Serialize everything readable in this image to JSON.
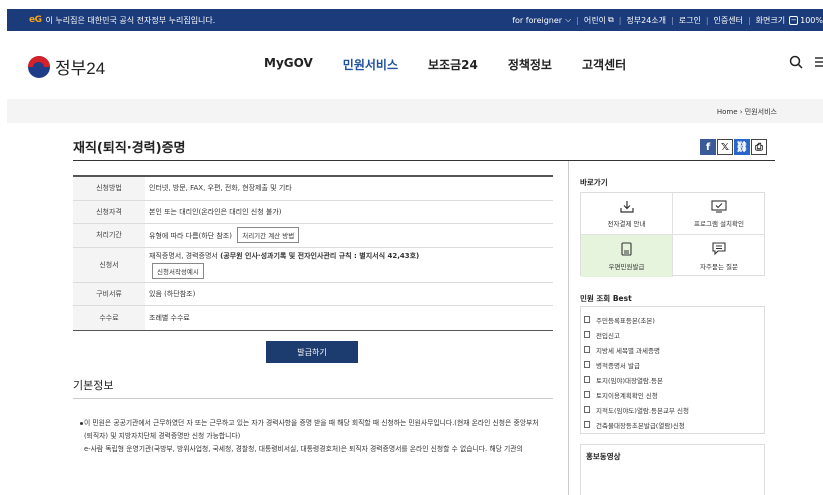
{
  "gov_banner": {
    "logo_text": "eG",
    "notice": "이 누리집은 대한민국 공식 전자정부 누리집입니다.",
    "links": [
      "for foreigner",
      "어린이",
      "정부24소개",
      "로그인",
      "인증센터",
      "화면크기",
      "100%"
    ]
  },
  "header": {
    "logo": "정부24",
    "nav": [
      "MyGOV",
      "민원서비스",
      "보조금24",
      "정책정보",
      "고객센터"
    ],
    "active_nav": "민원서비스",
    "icons": [
      "search-icon",
      "menu-icon"
    ]
  },
  "breadcrumb": [
    "Home",
    "민원서비스"
  ],
  "page": {
    "title": "재직(퇴직·경력)증명"
  },
  "share_icons": [
    "facebook-icon",
    "x-icon",
    "link-icon",
    "print-icon"
  ],
  "info_rows": [
    {
      "label": "신청방법",
      "value": "인터넷, 방문, FAX, 우편, 전화, 현장제출 및 기타"
    },
    {
      "label": "신청자격",
      "value": "본인 또는 대리인(온라인은 대리인 신청 불가)"
    },
    {
      "label": "처리기간",
      "value": "유형에 따라 다름(하단 참조)",
      "button": "처리기간 계산 방법"
    },
    {
      "label": "신청서",
      "value_prefix": "재직증명서, 경력증명서 ",
      "value_bold": "(공무원 인사·성과기록 및 전자인사관리 규칙 : 별지서식 42,43호)",
      "button": "신청서작성예시"
    },
    {
      "label": "구비서류",
      "value": "있음 (하단참조)"
    },
    {
      "label": "수수료",
      "value": "조례별 수수료"
    }
  ],
  "apply_button": "발급하기",
  "basic_info": {
    "title": "기본정보",
    "paragraph": "이 민원은 공공기관에서 근무하였던 자 또는 근무하고 있는 자가 경력사항을 증명 받을 때 해당 회직할 때 신청하는 민원사무입니다.(현재 온라인 신청은 중앙부처(퇴직자) 및 지방자치단체 경력증명만 신청 가능합니다)",
    "paragraph2": "e-사람 독립형 운영기관(국방부, 방위사업청, 국세청, 경찰청, 대통령비서실, 대통령경호처)은 퇴직자 경력증명서를 온라인 신청할 수 없습니다. 해당 기관의"
  },
  "sidebar": {
    "shortcut_title": "바로가기",
    "shortcuts": [
      {
        "label": "전자결제 안내",
        "icon": "download-icon"
      },
      {
        "label": "프로그램 설치확인",
        "icon": "monitor-check-icon"
      },
      {
        "label": "우편민원발급",
        "icon": "document-icon"
      },
      {
        "label": "자주묻는 질문",
        "icon": "chat-icon"
      }
    ],
    "best_title": "민원 조회 Best",
    "best_items": [
      "주민등록표등본(초본)",
      "전입신고",
      "지방세 세목별 과세증명",
      "병적증명서 발급",
      "토지(임야)대장열람.등본",
      "토지이용계획확인 신청",
      "지적도(임야도)열람.등본교부 신청",
      "건축물대장등초본발급(열람)신청"
    ],
    "video_title": "홍보동영상"
  },
  "colors": {
    "banner_bg": "#1c3b7a",
    "active_nav": "#1f4fa0",
    "apply_button": "#1c3b6e",
    "highlight_tile": "#e6f3dd"
  }
}
